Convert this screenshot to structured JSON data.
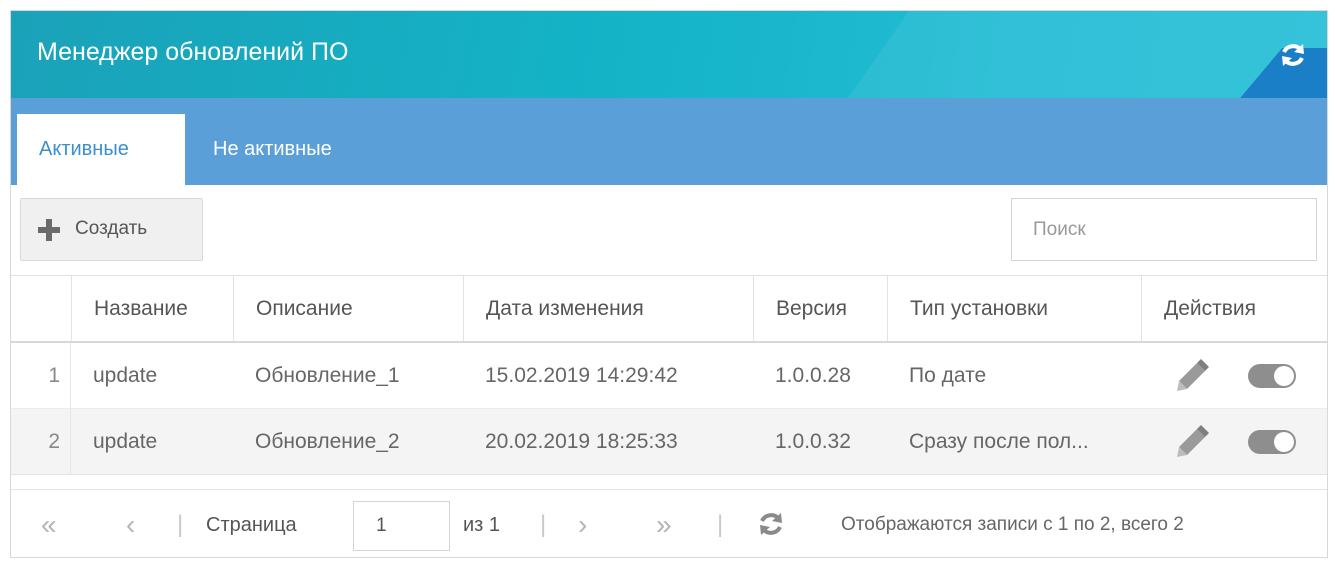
{
  "header": {
    "title": "Менеджер обновлений ПО",
    "refresh_icon": "refresh-icon"
  },
  "tabs": [
    {
      "label": "Активные",
      "active": true
    },
    {
      "label": "Не активные",
      "active": false
    }
  ],
  "toolbar": {
    "create_label": "Создать",
    "create_icon": "plus-icon"
  },
  "search": {
    "placeholder": "Поиск",
    "value": ""
  },
  "table": {
    "columns": [
      "",
      "Название",
      "Описание",
      "Дата изменения",
      "Версия",
      "Тип установки",
      "Действия"
    ],
    "rows": [
      {
        "num": "1",
        "name": "update",
        "description": "Обновление_1",
        "date": "15.02.2019 14:29:42",
        "version": "1.0.0.28",
        "install_type": "По дате",
        "enabled": true
      },
      {
        "num": "2",
        "name": "update",
        "description": "Обновление_2",
        "date": "20.02.2019 18:25:33",
        "version": "1.0.0.32",
        "install_type": "Сразу после пол...",
        "enabled": true
      }
    ]
  },
  "pager": {
    "first": "«",
    "prev": "‹",
    "next": "›",
    "last": "»",
    "separator": "|",
    "page_label": "Страница",
    "page_value": "1",
    "of_label": "из 1",
    "info": "Отображаются записи с 1 по 2, всего 2"
  },
  "colors": {
    "header_accent": "#14b3c6",
    "tabbar": "#5b9fd9",
    "active_tab_text": "#3a8fd0"
  }
}
